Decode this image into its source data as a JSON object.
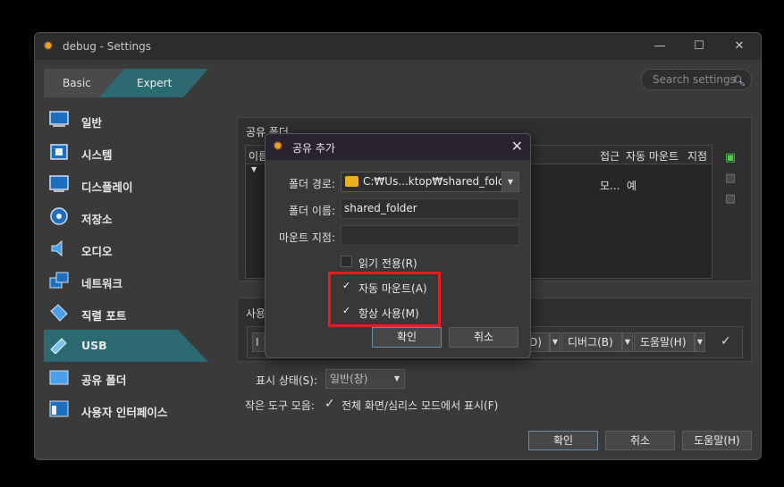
{
  "window": {
    "title": "debug - Settings",
    "minimize": "—",
    "maximize": "☐",
    "close": "✕"
  },
  "mode_tabs": {
    "basic": "Basic",
    "expert": "Expert"
  },
  "search": {
    "placeholder": "Search settings"
  },
  "sidebar": {
    "items": [
      {
        "label": "일반",
        "icon": "monitor-icon"
      },
      {
        "label": "시스템",
        "icon": "chip-icon"
      },
      {
        "label": "디스플레이",
        "icon": "display-icon"
      },
      {
        "label": "저장소",
        "icon": "disk-icon"
      },
      {
        "label": "오디오",
        "icon": "speaker-icon"
      },
      {
        "label": "네트워크",
        "icon": "network-icon"
      },
      {
        "label": "직렬 포트",
        "icon": "serial-port-icon"
      },
      {
        "label": "USB",
        "icon": "usb-icon",
        "selected": true
      },
      {
        "label": "공유 폴더",
        "icon": "folder-icon"
      },
      {
        "label": "사용자 인터페이스",
        "icon": "ui-icon"
      }
    ]
  },
  "shared_folders": {
    "title": "공유 폴더",
    "columns": {
      "name": "이름",
      "access": "접근",
      "automount": "자동 마운트",
      "mount_point": "지점"
    },
    "row": {
      "access": "모...",
      "automount": "예"
    }
  },
  "user_interface": {
    "title_fragment": "사용",
    "menu_fragment_1": "I",
    "menu_fragment_2": "D)",
    "debug_menu": "디버그(B)",
    "help_menu": "도움말(H)",
    "status_label": "표시 상태(S):",
    "status_value": "일반(창)",
    "mini_toolbar_label": "작은 도구 모음:",
    "mini_toolbar_option": "전체 화면/심리스 모드에서 표시(F)",
    "checkmark": "✓"
  },
  "footer": {
    "ok": "확인",
    "cancel": "취소",
    "help": "도움말(H)"
  },
  "dialog": {
    "title": "공유 추가",
    "close": "✕",
    "path_label": "폴더 경로:",
    "path_value": "C:₩Us...ktop₩shared_folder",
    "name_label": "폴더 이름:",
    "name_value": "shared_folder",
    "mount_label": "마운트 지점:",
    "mount_value": "",
    "readonly_label": "읽기 전용(R)",
    "readonly_checked": false,
    "automount_label": "자동 마운트(A)",
    "automount_checked": true,
    "permanent_label": "항상 사용(M)",
    "permanent_checked": true,
    "check": "✓",
    "ok": "확인",
    "cancel": "취소",
    "highlight_color": "#e02020"
  }
}
